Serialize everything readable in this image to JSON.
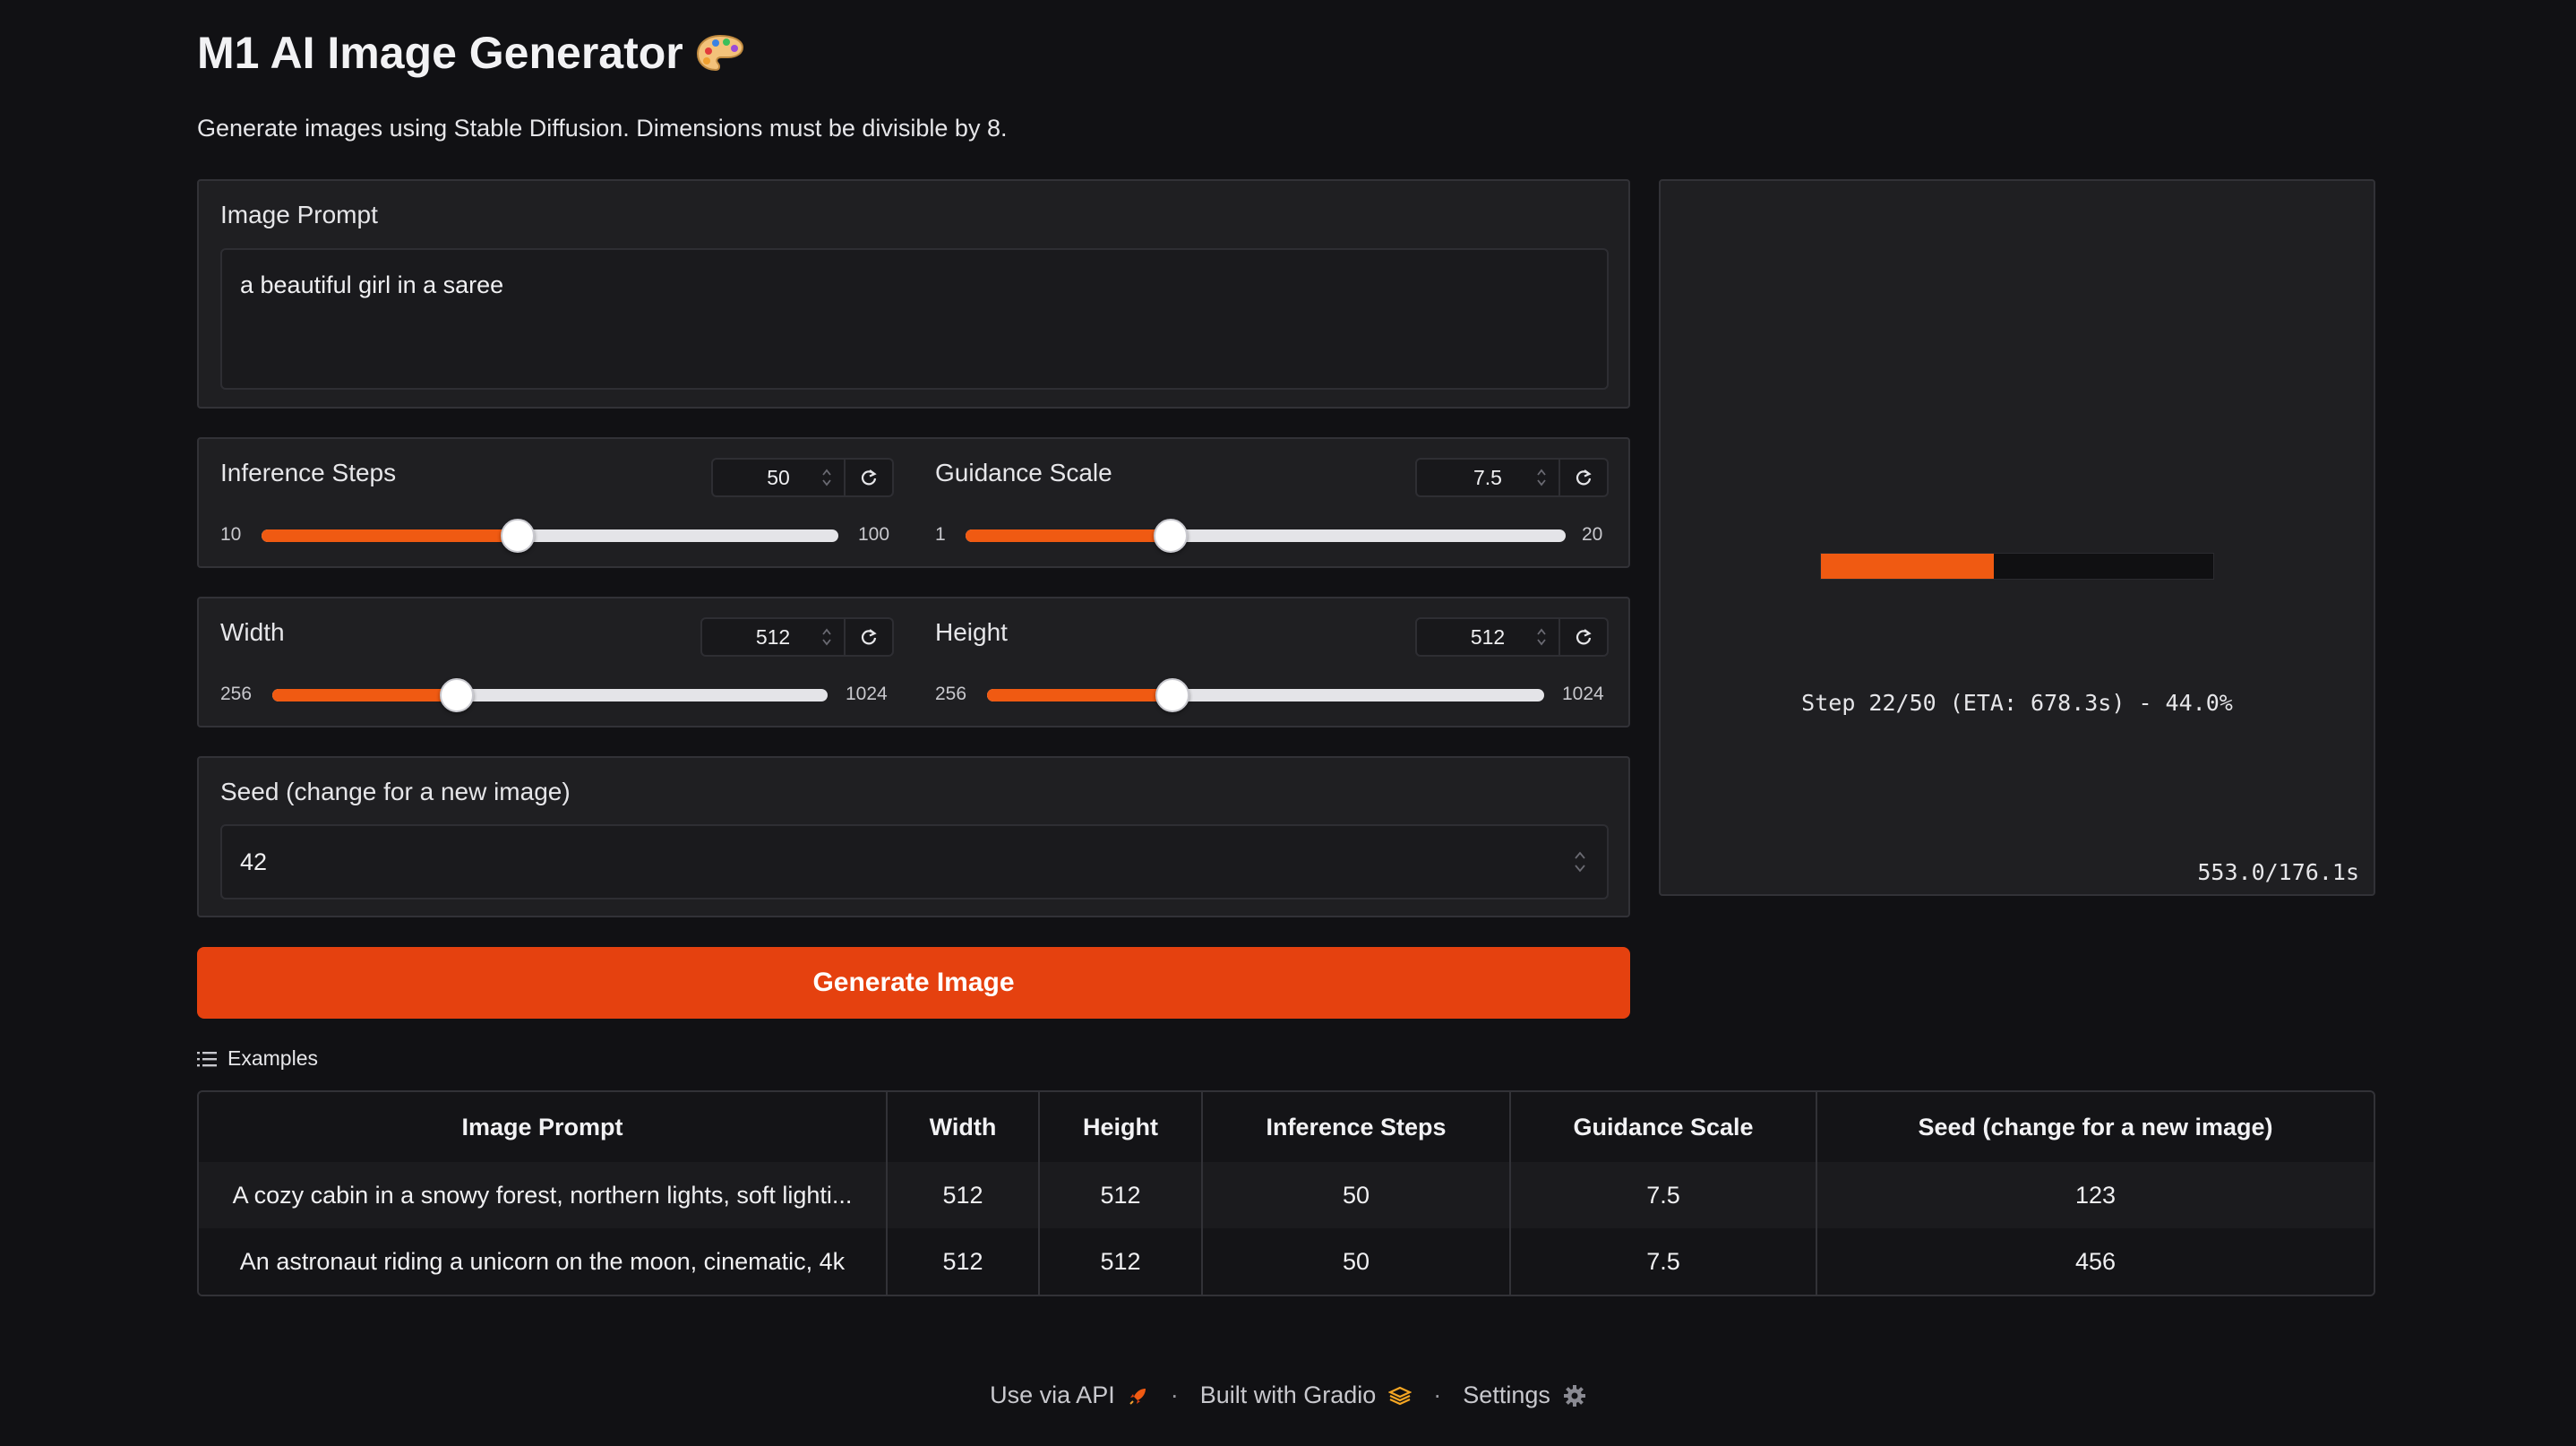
{
  "header": {
    "title": "M1 AI Image Generator",
    "title_icon": "palette-icon",
    "subtitle": "Generate images using Stable Diffusion. Dimensions must be divisible by 8."
  },
  "prompt": {
    "label": "Image Prompt",
    "value": "a beautiful girl in a saree"
  },
  "inference_steps": {
    "label": "Inference Steps",
    "value": "50",
    "min": "10",
    "max": "100",
    "fraction": 0.444
  },
  "guidance_scale": {
    "label": "Guidance Scale",
    "value": "7.5",
    "min": "1",
    "max": "20",
    "fraction": 0.342
  },
  "width": {
    "label": "Width",
    "value": "512",
    "min": "256",
    "max": "1024",
    "fraction": 0.333
  },
  "height": {
    "label": "Height",
    "value": "512",
    "min": "256",
    "max": "1024",
    "fraction": 0.333
  },
  "seed": {
    "label": "Seed (change for a new image)",
    "value": "42"
  },
  "generate_button": "Generate Image",
  "output": {
    "progress_text": "Step 22/50 (ETA: 678.3s) - 44.0%",
    "progress_fraction": 0.44,
    "timer": "553.0/176.1s"
  },
  "examples": {
    "label": "Examples",
    "headers": [
      "Image Prompt",
      "Width",
      "Height",
      "Inference Steps",
      "Guidance Scale",
      "Seed (change for a new image)"
    ],
    "rows": [
      [
        "A cozy cabin in a snowy forest, northern lights, soft lighti...",
        "512",
        "512",
        "50",
        "7.5",
        "123"
      ],
      [
        "An astronaut riding a unicorn on the moon, cinematic, 4k",
        "512",
        "512",
        "50",
        "7.5",
        "456"
      ]
    ]
  },
  "footer": {
    "api": "Use via API",
    "gradio": "Built with Gradio",
    "settings": "Settings",
    "separator": "·"
  },
  "colors": {
    "accent": "#e5410f",
    "slider_fill": "#f05a12",
    "background": "#111114",
    "panel": "#1f1f22"
  }
}
